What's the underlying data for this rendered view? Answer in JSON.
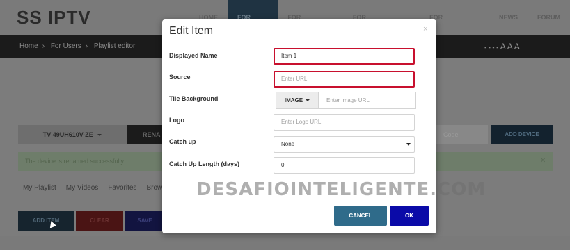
{
  "site": {
    "logo": "SS IPTV"
  },
  "topnav": [
    "HOME",
    "FOR USERS",
    "FOR OPERATORS",
    "FOR BROADCASTERS",
    "FOR ADVERTISERS",
    "NEWS",
    "FORUM"
  ],
  "breadcrumb": [
    "Home",
    "For Users",
    "Playlist editor"
  ],
  "font_size_controls": "A A A",
  "background": {
    "device_select": "TV 49UH610V-ZE",
    "rename_label": "RENA",
    "right_input_placeholder": "Code",
    "add_device_label": "ADD DEVICE",
    "success_message": "The device is renamed successfully",
    "tabs": [
      "My Playlist",
      "My Videos",
      "Favorites",
      "Brow"
    ],
    "buttons": {
      "add_item": "ADD ITEM",
      "clear": "CLEAR",
      "save": "SAVE"
    }
  },
  "modal": {
    "title": "Edit Item",
    "close_icon": "close-icon",
    "fields": {
      "displayed_name": {
        "label": "Displayed Name",
        "value": "Item 1"
      },
      "source": {
        "label": "Source",
        "placeholder": "Enter URL"
      },
      "tile_background": {
        "label": "Tile Background",
        "type_button": "IMAGE",
        "placeholder": "Enter Image URL"
      },
      "logo": {
        "label": "Logo",
        "placeholder": "Enter Logo URL"
      },
      "catch_up": {
        "label": "Catch up",
        "value": "None"
      },
      "catch_up_length": {
        "label": "Catch Up Length (days)",
        "value": "0"
      }
    },
    "buttons": {
      "cancel": "CANCEL",
      "ok": "OK"
    }
  },
  "watermark": "DESAFIOINTELIGENTE.COM",
  "colors": {
    "highlight_red": "#c8102e",
    "ok_blue": "#0a0aa8",
    "cancel_teal": "#2f6b8a"
  }
}
